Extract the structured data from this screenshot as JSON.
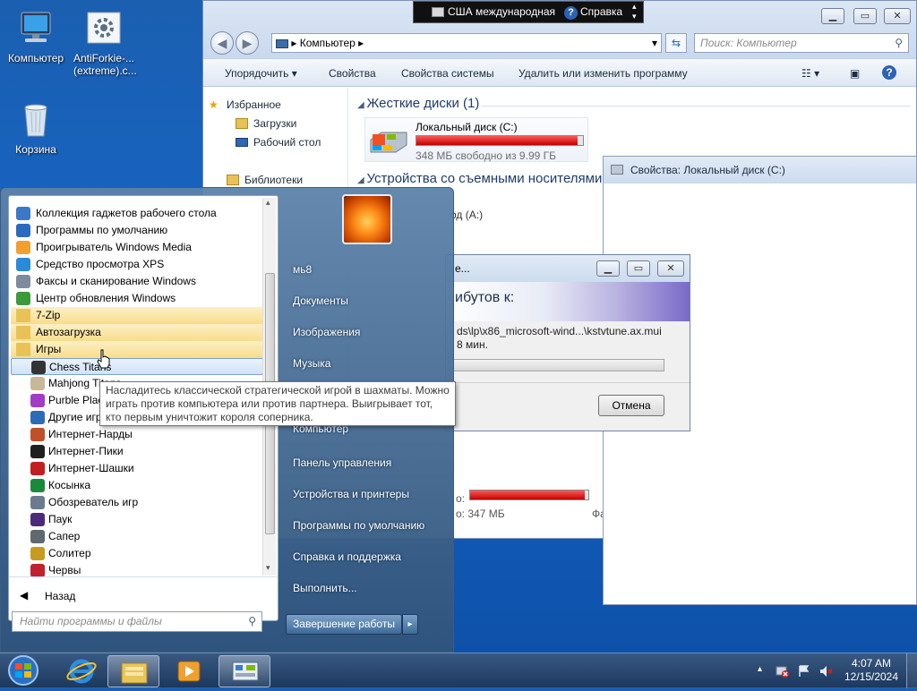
{
  "desktop": {
    "icons": [
      {
        "label": "Компьютер"
      },
      {
        "label": "AntiForkie-...\n(extreme).c..."
      },
      {
        "label": "Корзина"
      }
    ]
  },
  "language_bar": {
    "language": "США международная",
    "help": "Справка"
  },
  "explorer": {
    "address": "Компьютер",
    "search_placeholder": "Поиск: Компьютер",
    "commands": [
      "Упорядочить",
      "Свойства",
      "Свойства системы",
      "Удалить или изменить программу"
    ],
    "nav": {
      "favorites": "Избранное",
      "downloads": "Загрузки",
      "desktop": "Рабочий стол",
      "libraries": "Библиотеки"
    },
    "groups": {
      "hard_drives": "Жесткие диски (1)",
      "removable": "Устройства со съемными носителями"
    },
    "drive": {
      "name": "Локальный диск (C:)",
      "free": "348 МБ свободно из 9.99 ГБ",
      "used_fraction": 0.97
    },
    "partial": {
      "floppy": "од (A:)",
      "free2_label": "о:",
      "free2_value": "о: 347 МБ",
      "fs": "Фа"
    }
  },
  "properties_window": {
    "title": "Свойства: Локальный диск (C:)"
  },
  "copy_dialog": {
    "title": "е...",
    "heading": "ибутов к:",
    "path": "ds\\lp\\x86_microsoft-wind...\\kstvtune.ax.mui",
    "time": "8 мин.",
    "cancel": "Отмена"
  },
  "start_menu": {
    "programs": [
      {
        "label": "Коллекция гаджетов рабочего стола",
        "icon": "gadgets-icon"
      },
      {
        "label": "Программы по умолчанию",
        "icon": "default-programs-icon"
      },
      {
        "label": "Проигрыватель Windows Media",
        "icon": "media-player-icon"
      },
      {
        "label": "Средство просмотра XPS",
        "icon": "xps-viewer-icon"
      },
      {
        "label": "Факсы и сканирование Windows",
        "icon": "fax-icon"
      },
      {
        "label": "Центр обновления Windows",
        "icon": "windows-update-icon"
      },
      {
        "label": "7-Zip",
        "icon": "folder-icon"
      },
      {
        "label": "Автозагрузка",
        "icon": "folder-icon"
      },
      {
        "label": "Игры",
        "icon": "folder-icon"
      },
      {
        "label": "Chess Titans",
        "icon": "chess-icon"
      },
      {
        "label": "Mahjong Titans",
        "icon": "mahjong-icon"
      },
      {
        "label": "Purble Place",
        "icon": "purble-icon"
      },
      {
        "label": "Другие игры",
        "icon": "more-games-icon"
      },
      {
        "label": "Интернет-Нарды",
        "icon": "backgammon-icon"
      },
      {
        "label": "Интернет-Пики",
        "icon": "spades-icon"
      },
      {
        "label": "Интернет-Шашки",
        "icon": "checkers-icon"
      },
      {
        "label": "Косынка",
        "icon": "solitaire-icon"
      },
      {
        "label": "Обозреватель игр",
        "icon": "games-explorer-icon"
      },
      {
        "label": "Паук",
        "icon": "spider-icon"
      },
      {
        "label": "Сапер",
        "icon": "minesweeper-icon"
      },
      {
        "label": "Солитер",
        "icon": "freecell-icon"
      },
      {
        "label": "Червы",
        "icon": "hearts-icon"
      }
    ],
    "back": "Назад",
    "search_placeholder": "Найти программы и файлы",
    "user": "мь8",
    "right_items": [
      "Документы",
      "Изображения",
      "Музыка",
      "Компьютер",
      "Панель управления",
      "Устройства и принтеры",
      "Программы по умолчанию",
      "Справка и поддержка",
      "Выполнить..."
    ],
    "shutdown": "Завершение работы"
  },
  "tooltip": {
    "text": "Насладитесь классической стратегической игрой в шахматы. Можно играть против компьютера или против партнера. Выигрывает тот, кто первым уничтожит короля соперника."
  },
  "taskbar": {
    "time": "4:07 AM",
    "date": "12/15/2024"
  }
}
